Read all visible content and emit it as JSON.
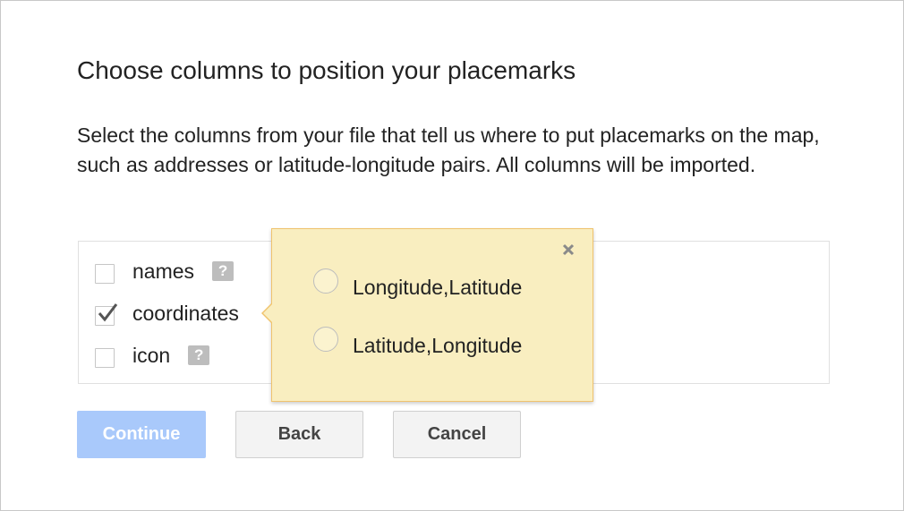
{
  "dialog": {
    "title": "Choose columns to position your placemarks",
    "description": "Select the columns from your file that tell us where to put placemarks on the map, such as addresses or latitude-longitude pairs. All columns will be imported."
  },
  "columns": [
    {
      "label": "names",
      "checked": false,
      "help_icon": "?"
    },
    {
      "label": "coordinates",
      "checked": true
    },
    {
      "label": "icon",
      "checked": false,
      "help_icon": "?"
    }
  ],
  "popup": {
    "options": [
      {
        "label": "Longitude,Latitude",
        "selected": false
      },
      {
        "label": "Latitude,Longitude",
        "selected": false
      }
    ],
    "close_icon": "close-icon"
  },
  "buttons": {
    "continue_label": "Continue",
    "back_label": "Back",
    "cancel_label": "Cancel"
  },
  "colors": {
    "popup_background": "#f9eec0",
    "popup_border": "#f0c36d",
    "continue_disabled": "#a9c9fb"
  }
}
